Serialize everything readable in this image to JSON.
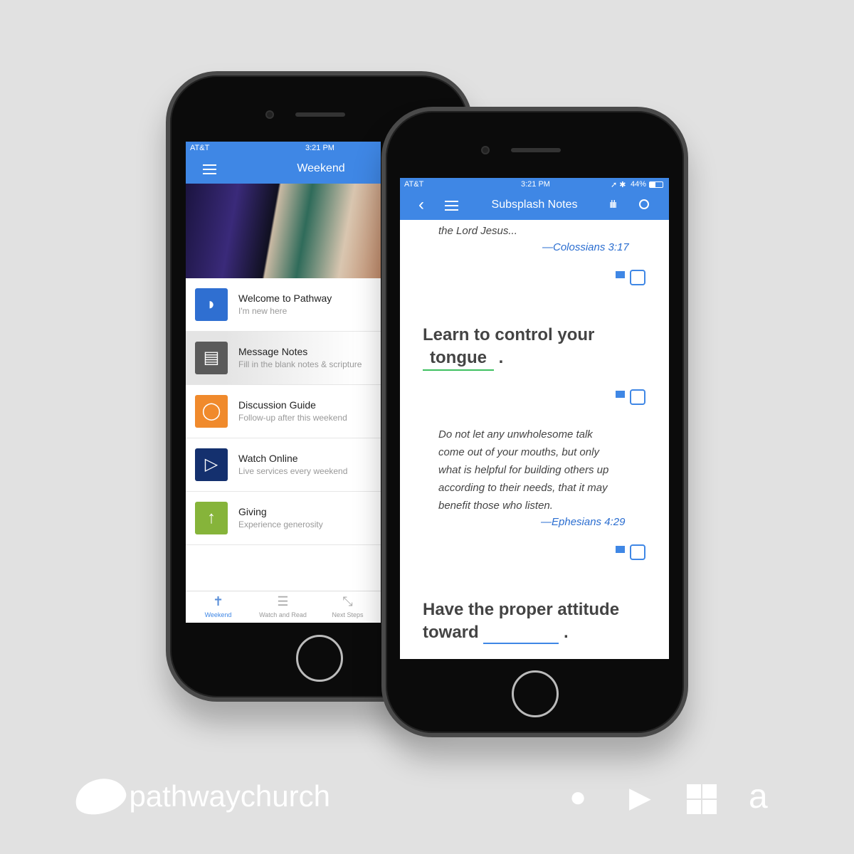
{
  "phone1": {
    "status": {
      "carrier": "AT&T",
      "time": "3:21 PM"
    },
    "header": {
      "title": "Weekend"
    },
    "items": [
      {
        "title": "Welcome to Pathway",
        "subtitle": "I'm new here",
        "icon": "pathway-logo-icon",
        "color": "#2f6fd1"
      },
      {
        "title": "Message Notes",
        "subtitle": "Fill in the blank notes & scripture",
        "icon": "notes-icon",
        "color": "#5a5a5a"
      },
      {
        "title": "Discussion Guide",
        "subtitle": "Follow-up after this weekend",
        "icon": "chat-bubble-icon",
        "color": "#f08a2c"
      },
      {
        "title": "Watch Online",
        "subtitle": "Live services every weekend",
        "icon": "play-icon",
        "color": "#14306e"
      },
      {
        "title": "Giving",
        "subtitle": "Experience generosity",
        "icon": "arrow-up-icon",
        "color": "#86b43a"
      }
    ],
    "tabs": [
      {
        "label": "Weekend",
        "active": true
      },
      {
        "label": "Watch and Read"
      },
      {
        "label": "Next Steps"
      }
    ]
  },
  "phone2": {
    "status": {
      "carrier": "AT&T",
      "time": "3:21 PM",
      "battery": "44%"
    },
    "header": {
      "title": "Subsplash Notes"
    },
    "quote1": {
      "text": "the Lord Jesus...",
      "ref": "—Colossians 3:17"
    },
    "point1": {
      "before": "Learn to control your",
      "blank": "tongue",
      "after": "."
    },
    "quote2": {
      "lines": [
        "Do not let any unwholesome talk",
        "come out of your mouths, but only",
        "what is helpful for building others up",
        "according to their needs, that it may",
        "benefit those who listen."
      ],
      "ref": "—Ephesians 4:29"
    },
    "point2": {
      "line1": "Have the proper attitude",
      "before": "toward",
      "after": "."
    }
  },
  "footer": {
    "brand": "pathwaychurch",
    "stores": [
      "apple-icon",
      "google-play-icon",
      "windows-icon",
      "amazon-icon"
    ]
  },
  "colors": {
    "accent": "#3f87e5",
    "background": "#e1e1e1"
  }
}
